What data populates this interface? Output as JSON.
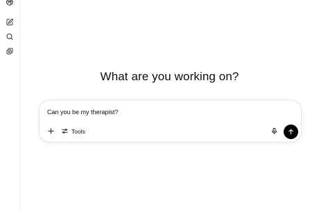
{
  "sidebar": {
    "icons": [
      "openai-logo-icon",
      "new-chat-icon",
      "search-icon",
      "library-icon"
    ]
  },
  "main": {
    "headline": "What are you working on?"
  },
  "composer": {
    "prompt": "Can you be my therapist?",
    "tools_label": "Tools"
  },
  "colors": {
    "text": "#0d0d0d",
    "send_button": "#000000",
    "border": "#e6e6e6"
  }
}
